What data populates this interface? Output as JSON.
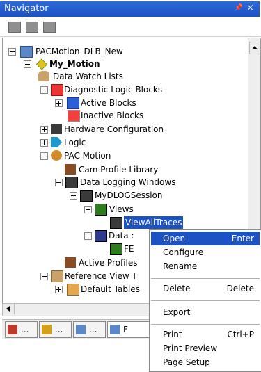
{
  "window": {
    "title": "Navigator",
    "pin_glyph": "1",
    "close_glyph": "×"
  },
  "toolbar": {
    "buttons": [
      "expand-all-icon",
      "collapse-all-icon",
      "properties-icon"
    ]
  },
  "tree": {
    "items": [
      {
        "label": "PACMotion_DLB_New",
        "icon": "project-icon"
      },
      {
        "label": "My_Motion",
        "icon": "target-icon"
      },
      {
        "label": "Data Watch Lists",
        "icon": "watch-lists-icon"
      },
      {
        "label": "Diagnostic Logic Blocks",
        "icon": "diagnostic-icon"
      },
      {
        "label": "Active Blocks",
        "icon": "active-blocks-icon"
      },
      {
        "label": "Inactive Blocks",
        "icon": "inactive-blocks-icon"
      },
      {
        "label": "Hardware Configuration",
        "icon": "hardware-icon"
      },
      {
        "label": "Logic",
        "icon": "logic-icon"
      },
      {
        "label": "PAC Motion",
        "icon": "pac-motion-icon"
      },
      {
        "label": "Cam Profile Library",
        "icon": "cam-library-icon"
      },
      {
        "label": "Data Logging Windows",
        "icon": "data-logging-icon"
      },
      {
        "label": "MyDLOGSession",
        "icon": "session-icon"
      },
      {
        "label": "Views",
        "icon": "views-icon"
      },
      {
        "label": "ViewAllTraces",
        "icon": "view-icon"
      },
      {
        "label": "Data :",
        "icon": "data-icon"
      },
      {
        "label": "FE",
        "icon": "fe-icon"
      },
      {
        "label": "Active Profiles",
        "icon": "active-profiles-icon"
      },
      {
        "label": "Reference View T",
        "icon": "reference-view-icon"
      },
      {
        "label": "Default Tables",
        "icon": "default-tables-icon"
      }
    ]
  },
  "tabs": [
    {
      "label": "...",
      "icon": "tab-icon-1"
    },
    {
      "label": "...",
      "icon": "tab-icon-2"
    },
    {
      "label": "...",
      "icon": "tab-icon-3"
    },
    {
      "label": "F",
      "icon": "tab-icon-4"
    }
  ],
  "context_menu": {
    "items": [
      {
        "label": "Open",
        "shortcut": "Enter"
      },
      {
        "label": "Configure",
        "shortcut": ""
      },
      {
        "label": "Rename",
        "shortcut": ""
      },
      {
        "label": "Delete",
        "shortcut": "Delete"
      },
      {
        "label": "Export",
        "shortcut": ""
      },
      {
        "label": "Print",
        "shortcut": "Ctrl+P"
      },
      {
        "label": "Print Preview",
        "shortcut": ""
      },
      {
        "label": "Page Setup",
        "shortcut": ""
      }
    ]
  },
  "colors": {
    "titlebar": "#1c52c4",
    "selection": "#1c52c4"
  }
}
